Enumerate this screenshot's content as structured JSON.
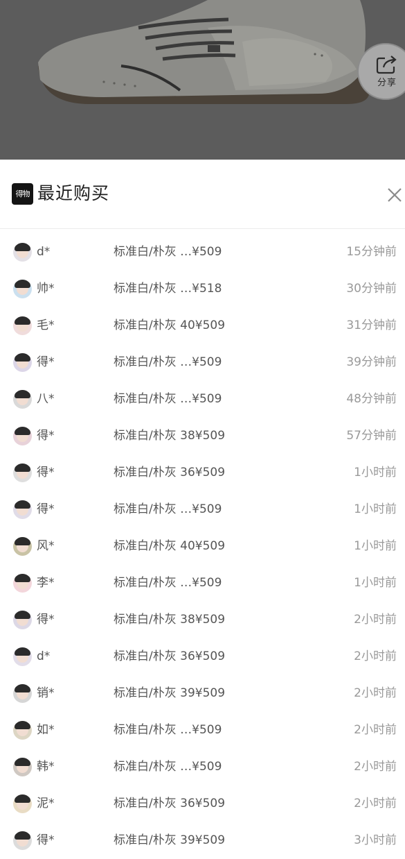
{
  "product": {
    "share_label": "分享",
    "share_icon": "share-icon"
  },
  "sheet": {
    "logo_text": "得物",
    "title": "最近购买",
    "close_icon": "close-icon"
  },
  "purchases": [
    {
      "name": "d*",
      "spec": "标准白/朴灰 …¥509",
      "time": "15分钟前",
      "avatar_color": "#e3e0e6"
    },
    {
      "name": "帅*",
      "spec": "标准白/朴灰 …¥518",
      "time": "30分钟前",
      "avatar_color": "#cbe0ef"
    },
    {
      "name": "毛*",
      "spec": "标准白/朴灰 40¥509",
      "time": "31分钟前",
      "avatar_color": "#f0dcdc"
    },
    {
      "name": "得*",
      "spec": "标准白/朴灰 …¥509",
      "time": "39分钟前",
      "avatar_color": "#dcd6e8"
    },
    {
      "name": "八*",
      "spec": "标准白/朴灰 …¥509",
      "time": "48分钟前",
      "avatar_color": "#d9d9d9"
    },
    {
      "name": "得*",
      "spec": "标准白/朴灰 38¥509",
      "time": "57分钟前",
      "avatar_color": "#e8d2d9"
    },
    {
      "name": "得*",
      "spec": "标准白/朴灰 36¥509",
      "time": "1小时前",
      "avatar_color": "#dedede"
    },
    {
      "name": "得*",
      "spec": "标准白/朴灰 …¥509",
      "time": "1小时前",
      "avatar_color": "#e0dce8"
    },
    {
      "name": "风*",
      "spec": "标准白/朴灰 40¥509",
      "time": "1小时前",
      "avatar_color": "#c9c3a5"
    },
    {
      "name": "李*",
      "spec": "标准白/朴灰 …¥509",
      "time": "1小时前",
      "avatar_color": "#f3d6db"
    },
    {
      "name": "得*",
      "spec": "标准白/朴灰 38¥509",
      "time": "2小时前",
      "avatar_color": "#dcd8e6"
    },
    {
      "name": "d*",
      "spec": "标准白/朴灰 36¥509",
      "time": "2小时前",
      "avatar_color": "#e2dde9"
    },
    {
      "name": "销*",
      "spec": "标准白/朴灰 39¥509",
      "time": "2小时前",
      "avatar_color": "#d6d6d6"
    },
    {
      "name": "如*",
      "spec": "标准白/朴灰 …¥509",
      "time": "2小时前",
      "avatar_color": "#ddd6c4"
    },
    {
      "name": "韩*",
      "spec": "标准白/朴灰 …¥509",
      "time": "2小时前",
      "avatar_color": "#cfc8c2"
    },
    {
      "name": "泥*",
      "spec": "标准白/朴灰 36¥509",
      "time": "2小时前",
      "avatar_color": "#e9dcc4"
    },
    {
      "name": "得*",
      "spec": "标准白/朴灰 39¥509",
      "time": "3小时前",
      "avatar_color": "#dcdcdc"
    }
  ]
}
